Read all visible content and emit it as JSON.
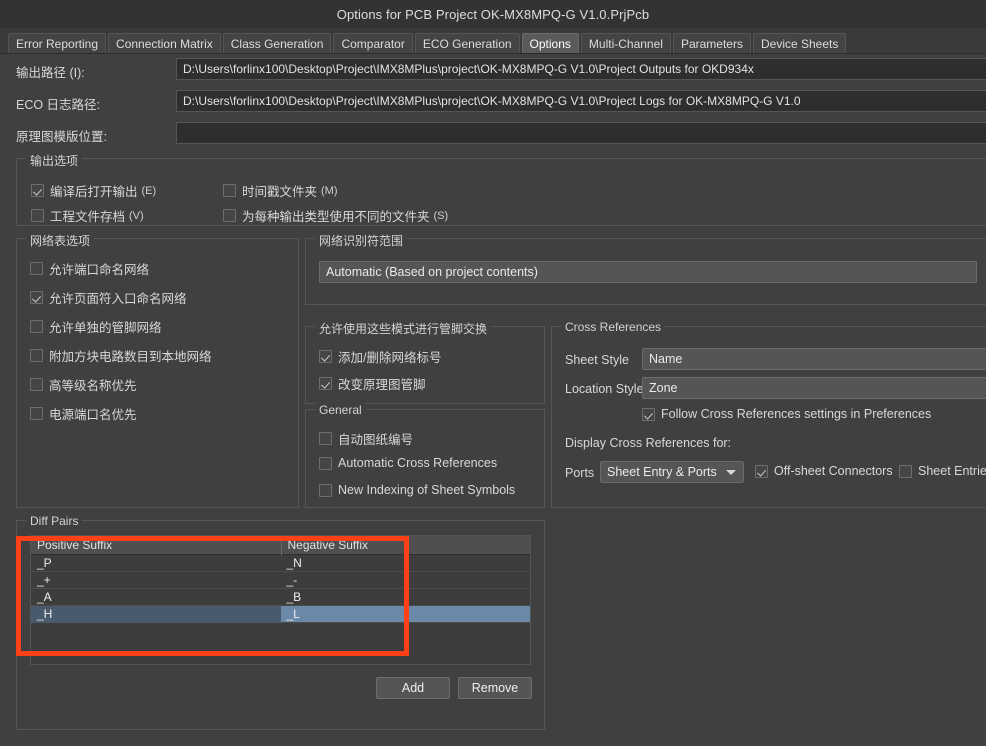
{
  "window": {
    "title": "Options for PCB Project OK-MX8MPQ-G V1.0.PrjPcb"
  },
  "tabs": [
    {
      "label": "Error Reporting",
      "active": false
    },
    {
      "label": "Connection Matrix",
      "active": false
    },
    {
      "label": "Class Generation",
      "active": false
    },
    {
      "label": "Comparator",
      "active": false
    },
    {
      "label": "ECO Generation",
      "active": false
    },
    {
      "label": "Options",
      "active": true
    },
    {
      "label": "Multi-Channel",
      "active": false
    },
    {
      "label": "Parameters",
      "active": false
    },
    {
      "label": "Device Sheets",
      "active": false
    }
  ],
  "paths": {
    "output_label": "输出路径 (I):",
    "output_value": "D:\\Users\\forlinx100\\Desktop\\Project\\IMX8MPlus\\project\\OK-MX8MPQ-G V1.0\\Project Outputs for OKD934x",
    "eco_label": "ECO 日志路径:",
    "eco_value": "D:\\Users\\forlinx100\\Desktop\\Project\\IMX8MPlus\\project\\OK-MX8MPQ-G V1.0\\Project Logs for OK-MX8MPQ-G V1.0",
    "template_label": "原理图模版位置:",
    "template_value": ""
  },
  "output_options": {
    "legend": "输出选项",
    "items": [
      {
        "label": "编译后打开输出",
        "mnemonic": "(E)",
        "checked": true
      },
      {
        "label": "时间戳文件夹",
        "mnemonic": "(M)",
        "checked": false
      },
      {
        "label": "工程文件存档",
        "mnemonic": "(V)",
        "checked": false
      },
      {
        "label": "为每种输出类型使用不同的文件夹",
        "mnemonic": "(S)",
        "checked": false
      }
    ]
  },
  "netlist_options": {
    "legend": "网络表选项",
    "items": [
      {
        "label": "允许端口命名网络",
        "checked": false
      },
      {
        "label": "允许页面符入口命名网络",
        "checked": true
      },
      {
        "label": "允许单独的管脚网络",
        "checked": false
      },
      {
        "label": "附加方块电路数目到本地网络",
        "checked": false
      },
      {
        "label": "高等级名称优先",
        "checked": false
      },
      {
        "label": "电源端口名优先",
        "checked": false
      }
    ]
  },
  "net_identifier_scope": {
    "legend": "网络识别符范围",
    "value": "Automatic (Based on project contents)"
  },
  "pin_swap": {
    "legend": "允许使用这些模式进行管脚交换",
    "items": [
      {
        "label": "添加/删除网络标号",
        "checked": true
      },
      {
        "label": "改变原理图管脚",
        "checked": true
      }
    ]
  },
  "general": {
    "legend": "General",
    "items": [
      {
        "label": "自动图纸编号",
        "checked": false
      },
      {
        "label": "Automatic Cross References",
        "checked": false
      },
      {
        "label": "New Indexing of Sheet Symbols",
        "checked": false
      }
    ]
  },
  "cross_references": {
    "legend": "Cross References",
    "sheet_style_label": "Sheet Style",
    "sheet_style_value": "Name",
    "location_style_label": "Location Style",
    "location_style_value": "Zone",
    "follow_label": "Follow Cross References settings in Preferences",
    "follow_checked": true,
    "display_for_label": "Display Cross References for:",
    "ports_label": "Ports",
    "ports_value": "Sheet Entry & Ports",
    "offsheet_label": "Off-sheet Connectors",
    "offsheet_checked": true,
    "sheet_entries_label": "Sheet Entries",
    "sheet_entries_checked": false
  },
  "diff_pairs": {
    "legend": "Diff Pairs",
    "columns": [
      "Positive Suffix",
      "Negative Suffix"
    ],
    "rows": [
      {
        "positive": "_P",
        "negative": "_N",
        "selected": false
      },
      {
        "positive": "_+",
        "negative": "_-",
        "selected": false
      },
      {
        "positive": "_A",
        "negative": "_B",
        "selected": false
      },
      {
        "positive": "_H",
        "negative": "_L",
        "selected": true
      }
    ],
    "add_label": "Add",
    "remove_label": "Remove"
  },
  "annotation": {
    "color": "#fa4019"
  }
}
